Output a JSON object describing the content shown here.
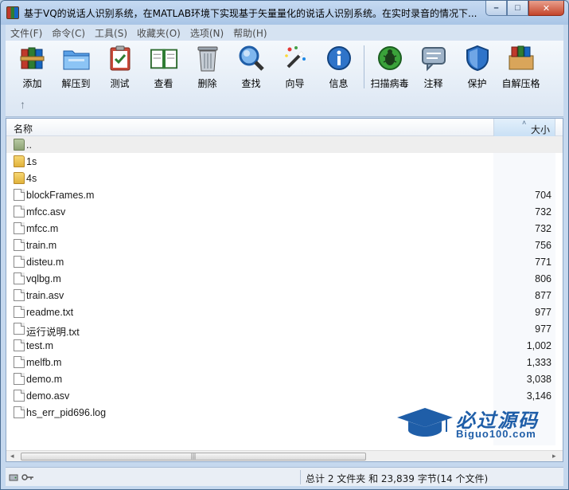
{
  "window": {
    "title": "基于VQ的说话人识别系统，在MATLAB环境下实现基于矢量量化的说话人识别系统。在实时录音的情况下...",
    "controls": [
      "–",
      "□",
      "✕"
    ]
  },
  "menu": [
    {
      "label": "文件(F)"
    },
    {
      "label": "命令(C)"
    },
    {
      "label": "工具(S)"
    },
    {
      "label": "收藏夹(O)"
    },
    {
      "label": "选项(N)"
    },
    {
      "label": "帮助(H)"
    }
  ],
  "toolbar": {
    "group1": [
      {
        "label": "添加",
        "icon": "books-icon"
      },
      {
        "label": "解压到",
        "icon": "folder-extract-icon"
      },
      {
        "label": "测试",
        "icon": "clipboard-check-icon"
      },
      {
        "label": "查看",
        "icon": "open-book-icon"
      },
      {
        "label": "删除",
        "icon": "trash-icon"
      },
      {
        "label": "查找",
        "icon": "magnifier-icon"
      },
      {
        "label": "向导",
        "icon": "magic-wand-icon"
      },
      {
        "label": "信息",
        "icon": "info-icon"
      }
    ],
    "group2": [
      {
        "label": "扫描病毒",
        "icon": "virus-scan-icon"
      },
      {
        "label": "注释",
        "icon": "comment-icon"
      },
      {
        "label": "保护",
        "icon": "shield-icon"
      },
      {
        "label": "自解压格",
        "icon": "sfx-box-icon"
      }
    ],
    "up_icon": "↑"
  },
  "list": {
    "col_name": "名称",
    "col_size": "大小",
    "sort_indicator": "˄",
    "rows": [
      {
        "name": "..",
        "size": "",
        "type": "parent"
      },
      {
        "name": "1s",
        "size": "",
        "type": "folder"
      },
      {
        "name": "4s",
        "size": "",
        "type": "folder"
      },
      {
        "name": "blockFrames.m",
        "size": "704",
        "type": "file"
      },
      {
        "name": "mfcc.asv",
        "size": "732",
        "type": "file"
      },
      {
        "name": "mfcc.m",
        "size": "732",
        "type": "file"
      },
      {
        "name": "train.m",
        "size": "756",
        "type": "file"
      },
      {
        "name": "disteu.m",
        "size": "771",
        "type": "file"
      },
      {
        "name": "vqlbg.m",
        "size": "806",
        "type": "file"
      },
      {
        "name": "train.asv",
        "size": "877",
        "type": "file"
      },
      {
        "name": "readme.txt",
        "size": "977",
        "type": "file"
      },
      {
        "name": "运行说明.txt",
        "size": "977",
        "type": "file"
      },
      {
        "name": "test.m",
        "size": "1,002",
        "type": "file"
      },
      {
        "name": "melfb.m",
        "size": "1,333",
        "type": "file"
      },
      {
        "name": "demo.m",
        "size": "3,038",
        "type": "file"
      },
      {
        "name": "demo.asv",
        "size": "3,146",
        "type": "file"
      },
      {
        "name": "hs_err_pid696.log",
        "size": "",
        "type": "file"
      }
    ]
  },
  "scrollbar": {
    "left_arrow": "◂",
    "right_arrow": "▸",
    "grip": "|||"
  },
  "watermark": {
    "title": "必过源码",
    "subtitle": "Biguo100.com"
  },
  "status": {
    "text": "总计 2 文件夹 和 23,839 字节(14 个文件)"
  },
  "colors": {
    "accent": "#1f5ea8",
    "toolbar_bg": "#dbe6f3",
    "frame": "#c5d8ee"
  }
}
